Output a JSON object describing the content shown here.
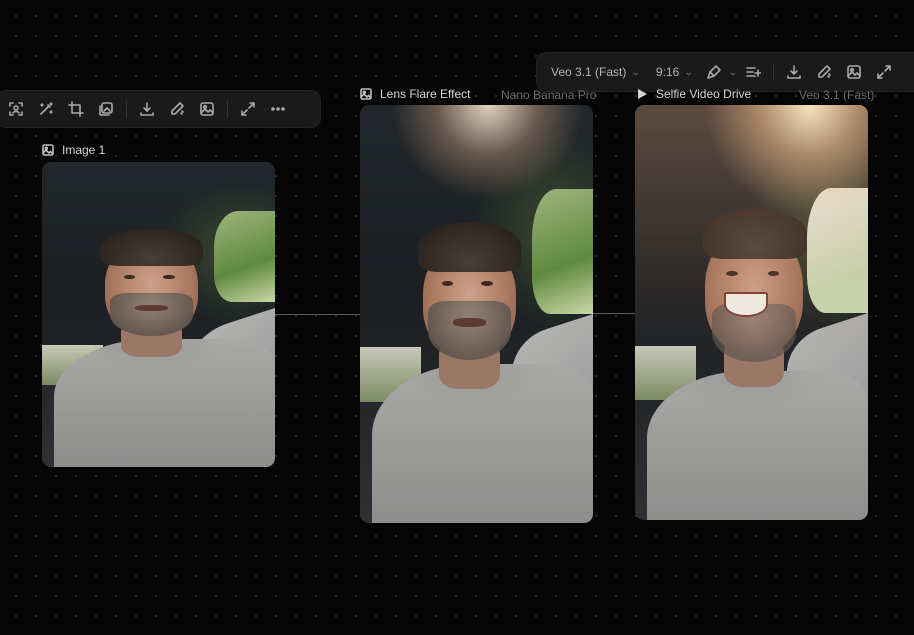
{
  "nodes": [
    {
      "type_icon": "image-icon",
      "label": "Image 1",
      "model": ""
    },
    {
      "type_icon": "image-icon",
      "label": "Lens Flare Effect",
      "model": "Nano Banana Pro"
    },
    {
      "type_icon": "play-icon",
      "label": "Selfie Video Drive",
      "model": "Veo 3.1 (Fast)"
    }
  ],
  "image_toolbar": {
    "buttons": [
      {
        "icon": "select-subject-icon"
      },
      {
        "icon": "magic-wand-icon"
      },
      {
        "icon": "crop-icon"
      },
      {
        "icon": "image-layers-icon"
      },
      {
        "icon": "download-icon"
      },
      {
        "icon": "edit-brush-icon"
      },
      {
        "icon": "image-generate-icon"
      },
      {
        "icon": "expand-icon"
      },
      {
        "icon": "more-icon"
      }
    ]
  },
  "video_toolbar": {
    "model_select": "Veo 3.1 (Fast)",
    "aspect_select": "9:16",
    "buttons": [
      {
        "icon": "brush-icon"
      },
      {
        "icon": "enhance-sparkle-icon"
      },
      {
        "icon": "download-icon"
      },
      {
        "icon": "edit-brush-icon"
      },
      {
        "icon": "image-generate-icon"
      },
      {
        "icon": "expand-icon"
      }
    ]
  },
  "colors": {
    "canvas": "#060606",
    "toolbar": "#1a1a1a",
    "label_text": "#d6d6d6",
    "model_text": "#6c6c6c",
    "connector": "#5a5a5a"
  }
}
